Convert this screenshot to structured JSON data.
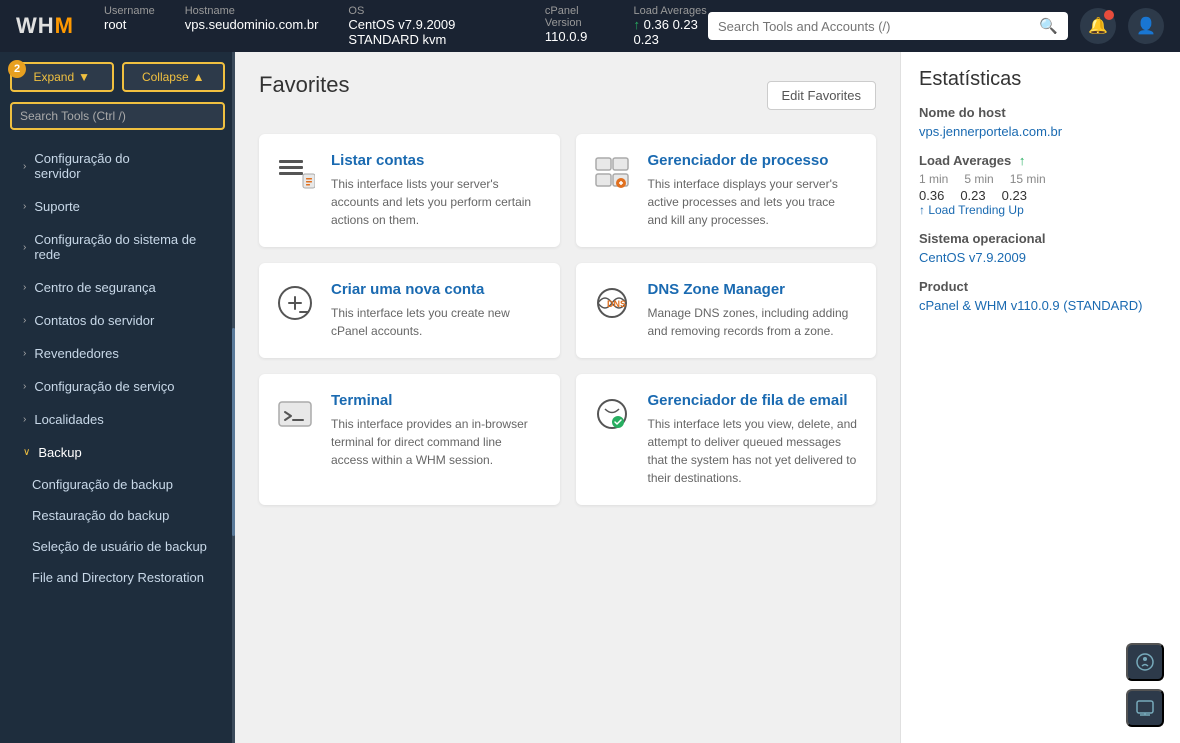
{
  "topbar": {
    "logo": "WHM",
    "username_label": "Username",
    "username_value": "root",
    "hostname_label": "Hostname",
    "hostname_value": "vps.seudominio.com.br",
    "os_label": "OS",
    "os_value": "CentOS v7.9.2009 STANDARD kvm",
    "cpanel_label": "cPanel Version",
    "cpanel_value": "110.0.9",
    "load_label": "Load Averages",
    "load_1": "0.36",
    "load_5": "0.23",
    "load_15": "0.23",
    "search_placeholder": "Search Tools and Accounts (/)"
  },
  "sidebar": {
    "expand_label": "Expand",
    "collapse_label": "Collapse",
    "search_placeholder": "Search Tools (Ctrl /)",
    "step_number": "2",
    "nav_items": [
      {
        "id": "configuracao-servidor",
        "label": "Configuração do servidor",
        "has_arrow": true,
        "expanded": false
      },
      {
        "id": "suporte",
        "label": "Suporte",
        "has_arrow": true,
        "expanded": false
      },
      {
        "id": "configuracao-rede",
        "label": "Configuração do sistema de rede",
        "has_arrow": true,
        "expanded": false
      },
      {
        "id": "centro-seguranca",
        "label": "Centro de segurança",
        "has_arrow": true,
        "expanded": false
      },
      {
        "id": "contatos-servidor",
        "label": "Contatos do servidor",
        "has_arrow": true,
        "expanded": false
      },
      {
        "id": "revendedores",
        "label": "Revendedores",
        "has_arrow": true,
        "expanded": false
      },
      {
        "id": "configuracao-servico",
        "label": "Configuração de serviço",
        "has_arrow": true,
        "expanded": false
      },
      {
        "id": "localidades",
        "label": "Localidades",
        "has_arrow": true,
        "expanded": false
      },
      {
        "id": "backup",
        "label": "Backup",
        "has_arrow": true,
        "expanded": true
      }
    ],
    "backup_sub_items": [
      {
        "id": "configuracao-backup",
        "label": "Configuração de backup"
      },
      {
        "id": "restauracao-backup",
        "label": "Restauração do backup"
      },
      {
        "id": "selecao-usuario-backup",
        "label": "Seleção de usuário de backup"
      },
      {
        "id": "file-directory-restoration",
        "label": "File and Directory Restoration"
      }
    ]
  },
  "main": {
    "favorites_title": "Favorites",
    "edit_favorites_label": "Edit Favorites",
    "cards": [
      {
        "id": "listar-contas",
        "title": "Listar contas",
        "description": "This interface lists your server's accounts and lets you perform certain actions on them.",
        "icon": "list"
      },
      {
        "id": "gerenciador-processo",
        "title": "Gerenciador de processo",
        "description": "This interface displays your server's active processes and lets you trace and kill any processes.",
        "icon": "process"
      },
      {
        "id": "criar-conta",
        "title": "Criar uma nova conta",
        "description": "This interface lets you create new cPanel accounts.",
        "icon": "add-account"
      },
      {
        "id": "dns-zone-manager",
        "title": "DNS Zone Manager",
        "description": "Manage DNS zones, including adding and removing records from a zone.",
        "icon": "dns"
      },
      {
        "id": "terminal",
        "title": "Terminal",
        "description": "This interface provides an in-browser terminal for direct command line access within a WHM session.",
        "icon": "terminal"
      },
      {
        "id": "gerenciador-fila-email",
        "title": "Gerenciador de fila de email",
        "description": "This interface lets you view, delete, and attempt to deliver queued messages that the system has not yet delivered to their destinations.",
        "icon": "email-queue"
      }
    ]
  },
  "stats": {
    "title": "Estatísticas",
    "hostname_label": "Nome do host",
    "hostname_value": "vps.jennerportela.com.br",
    "load_label": "Load Averages",
    "load_1_label": "1 min",
    "load_5_label": "5 min",
    "load_15_label": "15 min",
    "load_1_val": "0.36",
    "load_5_val": "0.23",
    "load_15_val": "0.23",
    "load_trending_label": "↑ Load Trending Up",
    "os_label": "Sistema operacional",
    "os_value": "CentOS v7.9.2009",
    "product_label": "Product",
    "product_value": "cPanel & WHM v110.0.9 (STANDARD)"
  }
}
